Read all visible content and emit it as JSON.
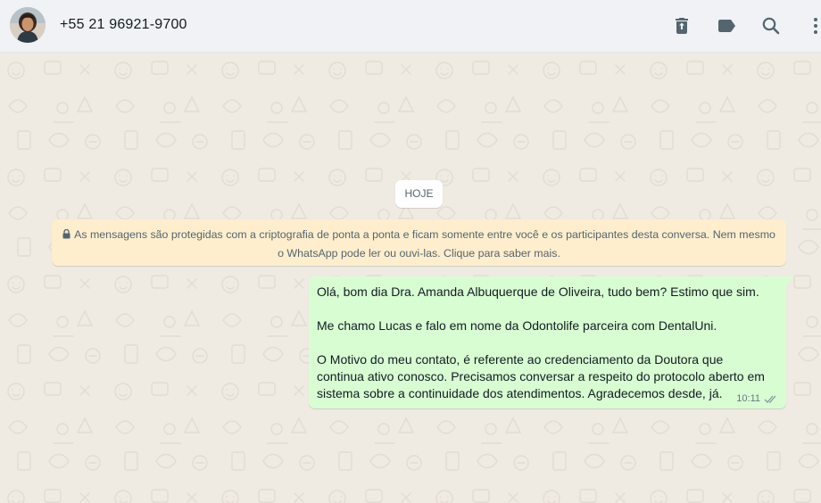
{
  "header": {
    "contact_name": "+55 21 96921-9700",
    "icons": [
      "avatar",
      "delete-icon",
      "label-icon",
      "search-icon",
      "more-options-icon"
    ]
  },
  "chat": {
    "date_label": "HOJE",
    "encryption_notice_line1": "As mensagens são protegidas com a criptografia de ponta a ponta e ficam somente entre você e os participantes desta conversa. Nem mesmo",
    "encryption_notice_line2": "o WhatsApp pode ler ou ouvi-las. Clique para saber mais.",
    "message": {
      "paragraphs": [
        "Olá, bom dia Dra. Amanda Albuquerque de Oliveira, tudo bem? Estimo que sim.",
        "Me chamo Lucas e falo em nome da Odontolife parceira com DentalUni.",
        "O Motivo do meu contato, é referente ao credenciamento da Doutora que continua ativo conosco. Precisamos conversar a respeito do protocolo aberto em sistema sobre a continuidade dos atendimentos. Agradecemos desde, já."
      ],
      "time": "10:11",
      "status": "read-double-tick"
    }
  },
  "colors": {
    "header_bg": "#f0f2f5",
    "chat_bg": "#efeae2",
    "outgoing_bubble": "#d9fdd3",
    "encryption_bg": "#ffeecd",
    "icon_color": "#54656f",
    "text_primary": "#111b21",
    "text_secondary": "#667781"
  }
}
